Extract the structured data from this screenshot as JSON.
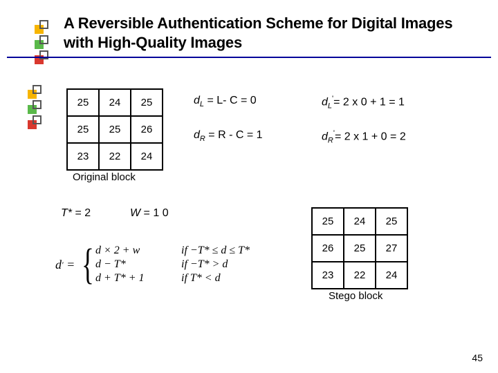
{
  "title": "A Reversible Authentication Scheme for Digital Images with High-Quality Images",
  "bullets": {
    "colors": [
      "#f7b500",
      "#5ab94a",
      "#d9382e"
    ]
  },
  "originalBlock": {
    "label": "Original block",
    "cells": [
      [
        "25",
        "24",
        "25"
      ],
      [
        "25",
        "25",
        "26"
      ],
      [
        "23",
        "22",
        "24"
      ]
    ]
  },
  "stegoBlock": {
    "label": "Stego block",
    "cells": [
      [
        "25",
        "24",
        "25"
      ],
      [
        "26",
        "25",
        "27"
      ],
      [
        "23",
        "22",
        "24"
      ]
    ]
  },
  "equations": {
    "dL": {
      "var": "d",
      "sub": "L",
      "body": " = L- C = 0"
    },
    "dR": {
      "var": "d",
      "sub": "R",
      "body": " = R - C = 1"
    },
    "dLp": {
      "var": "d",
      "sub": "L",
      "prime": "'",
      "body": "= 2 x 0 + 1 = 1"
    },
    "dRp": {
      "var": "d",
      "sub": "R",
      "prime": "'",
      "body": "= 2 x 1 + 0 = 2"
    }
  },
  "params": {
    "Tstar": {
      "lhs": "T*",
      "eq": " = 2"
    },
    "W": {
      "lhs": "W",
      "eq": " = 1 0"
    }
  },
  "formula": {
    "lhs_var": "d",
    "lhs_prime": "'",
    "cases": [
      {
        "expr": "d × 2 + w",
        "cond": "if  −T* ≤ d ≤ T*"
      },
      {
        "expr": "d − T*",
        "cond": "if  −T* > d"
      },
      {
        "expr": "d + T* + 1",
        "cond": "if  T* < d"
      }
    ]
  },
  "slideNumber": "45"
}
